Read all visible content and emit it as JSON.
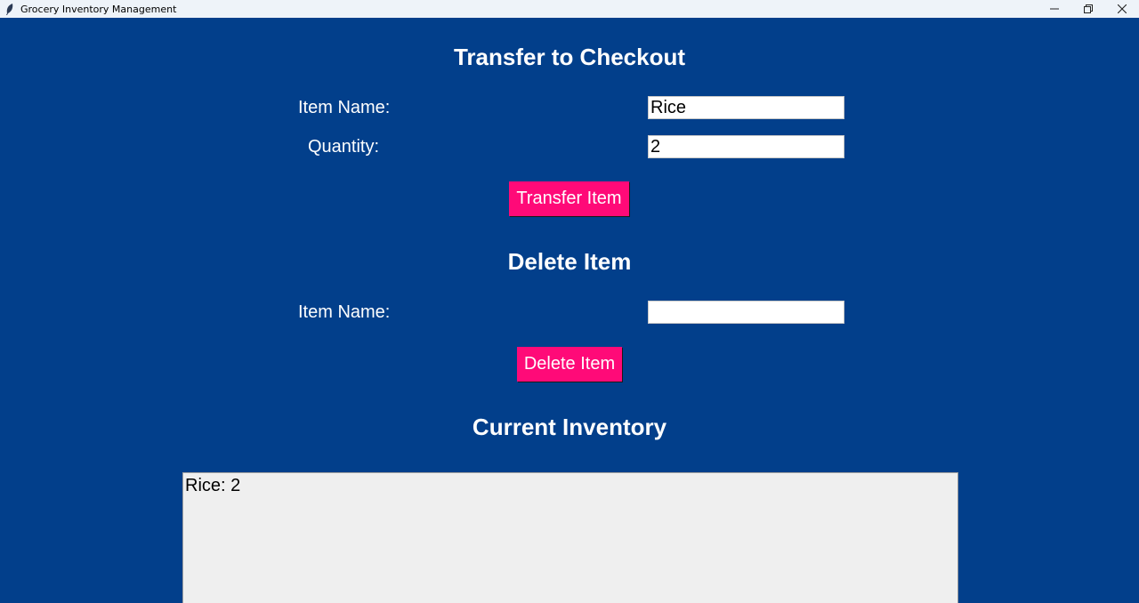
{
  "window": {
    "title": "Grocery Inventory Management",
    "controls": {
      "minimize": "minimize-icon",
      "restore": "restore-icon",
      "close": "close-icon"
    }
  },
  "colors": {
    "background": "#023f8b",
    "button": "#ff0a78",
    "listbox": "#efefef"
  },
  "transfer": {
    "heading": "Transfer to Checkout",
    "item_name_label": "Item Name:",
    "item_name_value": "Rice",
    "quantity_label": "Quantity:",
    "quantity_value": "2",
    "button_label": "Transfer Item"
  },
  "delete": {
    "heading": "Delete Item",
    "item_name_label": "Item Name:",
    "item_name_value": "",
    "button_label": "Delete Item"
  },
  "inventory": {
    "heading": "Current Inventory",
    "items": [
      "Rice: 2"
    ]
  }
}
